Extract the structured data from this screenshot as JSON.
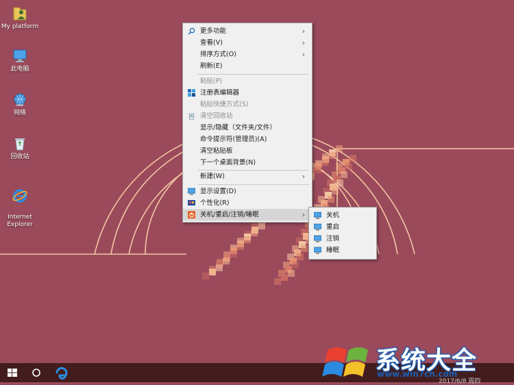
{
  "desktop": {
    "icons": [
      {
        "label": "My platform",
        "icon": "user-folder-icon"
      },
      {
        "label": "此电脑",
        "icon": "computer-icon"
      },
      {
        "label": "网络",
        "icon": "network-icon"
      },
      {
        "label": "回收站",
        "icon": "recycle-bin-icon"
      },
      {
        "label": "Internet\nExplorer",
        "icon": "ie-icon"
      }
    ]
  },
  "context_menu": {
    "items": [
      {
        "label": "更多功能",
        "icon": "search-icon",
        "submenu": true,
        "enabled": true
      },
      {
        "label": "查看(V)",
        "submenu": true,
        "enabled": true
      },
      {
        "label": "排序方式(O)",
        "submenu": true,
        "enabled": true
      },
      {
        "label": "刷新(E)",
        "enabled": true
      },
      {
        "label": "粘贴(P)",
        "enabled": false
      },
      {
        "label": "注册表编辑器",
        "icon": "registry-icon",
        "enabled": true
      },
      {
        "label": "粘贴快捷方式(S)",
        "enabled": false
      },
      {
        "label": "清空回收站",
        "icon": "recycle-icon",
        "enabled": false
      },
      {
        "label": "显示/隐藏（文件夹/文件）",
        "enabled": true
      },
      {
        "label": "命令提示符(管理员)(A)",
        "enabled": true
      },
      {
        "label": "清空粘贴板",
        "enabled": true
      },
      {
        "label": "下一个桌面背景(N)",
        "enabled": true
      },
      {
        "label": "新建(W)",
        "submenu": true,
        "enabled": true
      },
      {
        "label": "显示设置(D)",
        "icon": "display-icon",
        "enabled": true
      },
      {
        "label": "个性化(R)",
        "icon": "personalize-icon",
        "enabled": true
      },
      {
        "label": "关机/重启/注销/睡眠",
        "icon": "power-icon",
        "submenu": true,
        "enabled": true,
        "highlighted": true
      }
    ]
  },
  "submenu": {
    "items": [
      {
        "label": "关机",
        "icon": "monitor-icon"
      },
      {
        "label": "重启",
        "icon": "monitor-icon"
      },
      {
        "label": "注销",
        "icon": "monitor-icon"
      },
      {
        "label": "睡眠",
        "icon": "monitor-icon"
      }
    ]
  },
  "taskbar": {
    "buttons": [
      "windows-start-icon",
      "cortana-circle-icon",
      "edge-icon"
    ]
  },
  "watermark": {
    "title": "系统大全",
    "url": "www.win7cn.com"
  },
  "clock": {
    "date": "2017/6/8 周四"
  },
  "colors": {
    "wallpaper": "#9b4a5c",
    "wallpaper_arcs": "#f3c7a2",
    "taskbar": "#431d1d",
    "menu_bg": "#f0f0f0",
    "menu_highlight": "#d6d6d6"
  }
}
